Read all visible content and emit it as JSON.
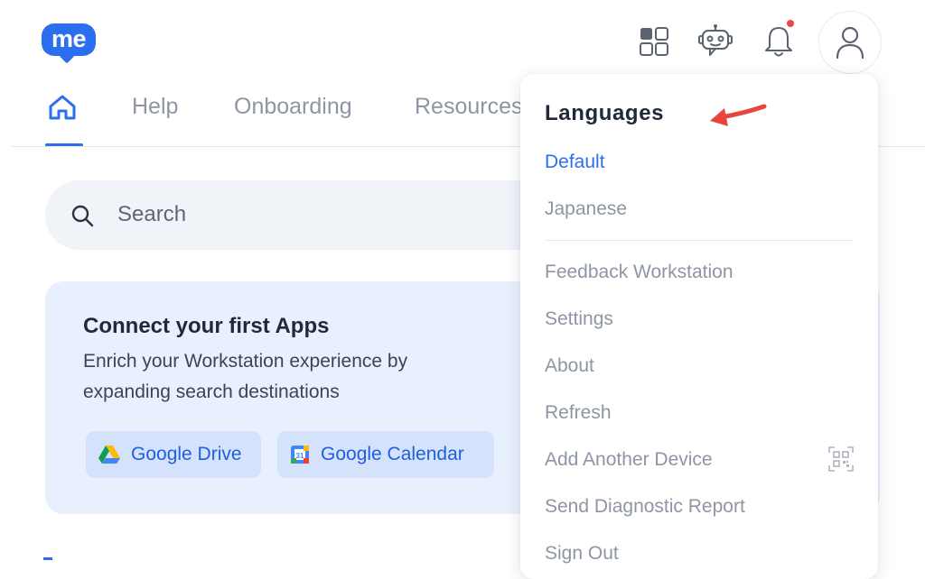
{
  "logo": {
    "text": "me"
  },
  "header": {
    "icons": [
      "apps-grid-icon",
      "bot-icon",
      "bell-icon",
      "user-icon"
    ],
    "notification_dot_color": "#e5484d"
  },
  "tabs": [
    {
      "label": "Help"
    },
    {
      "label": "Onboarding"
    },
    {
      "label": "Resources"
    }
  ],
  "search": {
    "placeholder": "Search"
  },
  "connect_card": {
    "title": "Connect your first Apps",
    "description": "Enrich your Workstation experience by expanding search destinations",
    "apps": [
      {
        "label": "Google Drive"
      },
      {
        "label": "Google Calendar"
      }
    ]
  },
  "menu": {
    "heading": "Languages",
    "languages": [
      {
        "label": "Default",
        "selected": true
      },
      {
        "label": "Japanese",
        "selected": false
      }
    ],
    "items": [
      {
        "label": "Feedback Workstation"
      },
      {
        "label": "Settings"
      },
      {
        "label": "About"
      },
      {
        "label": "Refresh"
      },
      {
        "label": "Add Another Device"
      },
      {
        "label": "Send Diagnostic Report"
      },
      {
        "label": "Sign Out"
      }
    ]
  },
  "colors": {
    "accent": "#2b6ef0",
    "muted_text": "#8e95a3",
    "annotation_arrow": "#e8453c"
  }
}
